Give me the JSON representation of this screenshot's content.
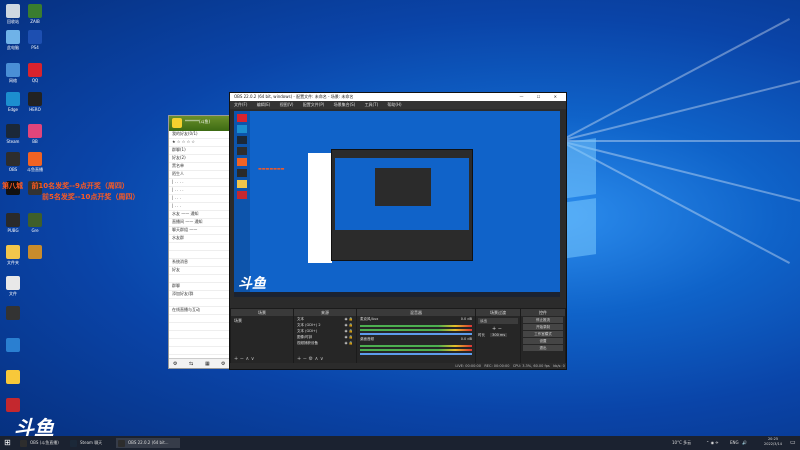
{
  "watermark": "斗鱼",
  "overlay": {
    "line1_a": "第八城",
    "line1_b": "前10名发奖--9点开奖（周四）",
    "line2": "前5名发奖--10点开奖（周四）"
  },
  "desktop_icons": [
    {
      "label": "回收站",
      "icon": "recycle-bin-icon",
      "color": "#cfd8e0"
    },
    {
      "label": "ZAIB",
      "icon": "app-icon",
      "color": "#3a7d2f"
    },
    {
      "label": "此电脑",
      "icon": "computer-icon",
      "color": "#6fb2e8"
    },
    {
      "label": "PS4",
      "icon": "playstation-icon",
      "color": "#1d4fb1"
    },
    {
      "label": "网络",
      "icon": "network-icon",
      "color": "#4a8fd6"
    },
    {
      "label": "QQ",
      "icon": "qq-icon",
      "color": "#d9232d"
    },
    {
      "label": "Edge",
      "icon": "edge-icon",
      "color": "#1c8fcf"
    },
    {
      "label": "HERO",
      "icon": "game-icon",
      "color": "#222"
    },
    {
      "label": "Steam",
      "icon": "steam-icon",
      "color": "#1b2838"
    },
    {
      "label": "BB",
      "icon": "app-icon",
      "color": "#e0457b"
    },
    {
      "label": "OBS",
      "icon": "obs-icon",
      "color": "#2d2d2d"
    },
    {
      "label": "斗鱼直播",
      "icon": "douyu-icon",
      "color": "#f06323"
    },
    {
      "label": "",
      "icon": "app-icon",
      "color": "#111"
    },
    {
      "label": "",
      "icon": "app-icon",
      "color": "#333"
    },
    {
      "label": "PUBG",
      "icon": "pubg-icon",
      "color": "#2a2a2a"
    },
    {
      "label": "Gre",
      "icon": "game-icon",
      "color": "#3f5f2a"
    },
    {
      "label": "文件夹",
      "icon": "folder-icon",
      "color": "#f2c64b"
    },
    {
      "label": "",
      "icon": "owl-icon",
      "color": "#c98c2c"
    },
    {
      "label": "文件",
      "icon": "file-icon",
      "color": "#e8e8e8"
    },
    {
      "label": "",
      "icon": "app-icon",
      "color": "#333"
    },
    {
      "label": "",
      "icon": "app-icon",
      "color": "#2a7fd1"
    },
    {
      "label": "",
      "icon": "app-icon",
      "color": "#f7c83a"
    },
    {
      "label": "",
      "icon": "app-icon",
      "color": "#c4282e"
    }
  ],
  "qq_window": {
    "title": "*******(斗鱼)",
    "rows": [
      "我的好友(0/1)",
      "★ ☆ ☆ ☆ ☆",
      "群聊(1)",
      "好友(2)",
      "黑名单",
      "陌生人",
      "|  .  .  .  .",
      "|  .  .  .  .",
      "|  .  .  .",
      "|  .  .  .",
      "水友 ——  通知",
      "直播间 ——  通知",
      "聊天群组  ——",
      "水友群",
      "",
      "",
      "系统消息",
      "好友",
      "",
      "群聊",
      "添加好友/群",
      "",
      "在线直播与互动",
      "",
      "",
      "",
      "",
      ""
    ]
  },
  "obs": {
    "title": "OBS 22.0.2 (64 bit, windows) - 配置文件: 未命名 - 场景: 未命名",
    "menu": [
      "文件(F)",
      "编辑(E)",
      "视图(V)",
      "配置文件(P)",
      "场景集合(S)",
      "工具(T)",
      "帮助(H)"
    ],
    "docks": {
      "scenes": "场景",
      "sources": "来源",
      "mixer": "混音器",
      "transitions": "场景过渡",
      "controls": "控件"
    },
    "scene_item": "场景",
    "sources": [
      "文本",
      "文本 (GDI+) 2",
      "文本 (GDI+)",
      "图像/时钟",
      "视频捕获设备"
    ],
    "mixer": [
      {
        "label": "麦克风/Aux",
        "db": "0.0 dB"
      },
      {
        "label": "桌面音频",
        "db": "0.0 dB"
      }
    ],
    "transition": {
      "name": "淡出",
      "duration_label": "时长",
      "duration": "300 ms"
    },
    "controls": [
      "停止推流",
      "开始录制",
      "工作室模式",
      "设置",
      "退出"
    ],
    "status": {
      "live": "LIVE: 00:00:00",
      "rec": "REC: 00:00:00",
      "cpu": "CPU: 3.3%, 60.00 fps",
      "kb": "kb/s: 0"
    }
  },
  "taskbar": {
    "items": [
      {
        "label": "OBS (斗鱼直播)",
        "color": "#2d2d2d"
      },
      {
        "label": "Steam 聊天",
        "color": "#1b2838"
      },
      {
        "label": "OBS 22.0.2 (64 bit...",
        "color": "#2d2d2d"
      }
    ],
    "tray": {
      "weather": "10°C 多云",
      "lang": "ENG",
      "time": "20:25",
      "date": "2022/3/14"
    }
  }
}
